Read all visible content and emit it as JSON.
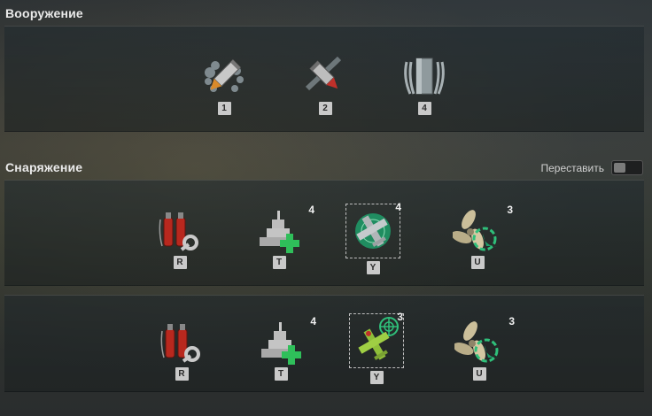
{
  "armament": {
    "title": "Вооружение",
    "slots": [
      {
        "icon": "he-shell-icon",
        "key": "1"
      },
      {
        "icon": "ap-shell-icon",
        "key": "2"
      },
      {
        "icon": "torpedo-launcher-icon",
        "key": "4"
      }
    ]
  },
  "consumables": {
    "title": "Снаряжение",
    "rearrange_label": "Переставить",
    "rows": [
      {
        "slots": [
          {
            "icon": "damage-control-party-icon",
            "key": "R",
            "count": ""
          },
          {
            "icon": "repair-party-icon",
            "key": "T",
            "count": "4"
          },
          {
            "icon": "spotting-aircraft-icon",
            "key": "Y",
            "count": "4",
            "selected": true
          },
          {
            "icon": "engine-boost-icon",
            "key": "U",
            "count": "3"
          }
        ]
      },
      {
        "slots": [
          {
            "icon": "damage-control-party-icon",
            "key": "R",
            "count": ""
          },
          {
            "icon": "repair-party-icon",
            "key": "T",
            "count": "4"
          },
          {
            "icon": "catapult-fighter-icon",
            "key": "Y",
            "count": "3",
            "selected": true
          },
          {
            "icon": "engine-boost-icon",
            "key": "U",
            "count": "3"
          }
        ]
      }
    ]
  },
  "colors": {
    "heal_green": "#2fbf5a",
    "radar_green": "#1e9e6a",
    "fuel_red": "#b8281e",
    "plane_green": "#8fbf3a"
  }
}
